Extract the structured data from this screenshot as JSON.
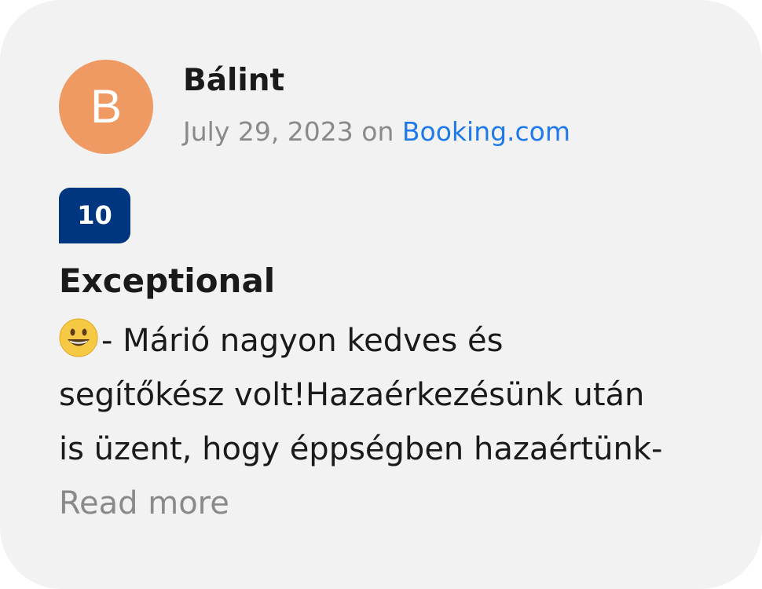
{
  "review": {
    "avatar_initial": "B",
    "author": "Bálint",
    "date": "July 29, 2023",
    "on_text": " on ",
    "source": "Booking.com",
    "score": "10",
    "headline": "Exceptional",
    "emoji_icon": "grinning-face-emoji",
    "text_lines": [
      "- Márió nagyon kedves és",
      "segítőkész volt!Hazaérkezésünk után",
      "is üzent, hogy éppségben hazaértünk-"
    ],
    "read_more": "Read more",
    "colors": {
      "avatar": "#ee9a62",
      "score_badge": "#003580",
      "link": "#1f7ae8",
      "muted": "#8a8a8a"
    }
  }
}
